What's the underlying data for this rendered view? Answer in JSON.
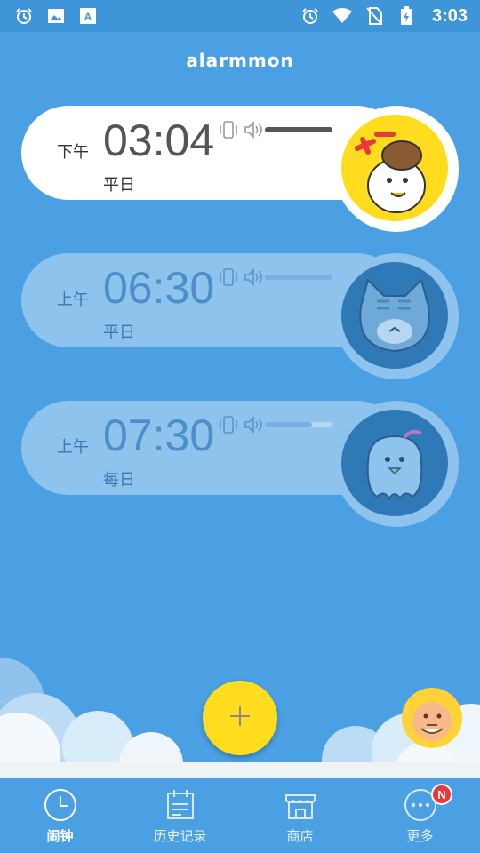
{
  "status_bar": {
    "time": "3:03",
    "left_icons": [
      "alarm-clock-icon",
      "image-icon",
      "text-a-icon"
    ],
    "right_icons": [
      "alarm-clock-icon",
      "wifi-icon",
      "no-sim-icon",
      "battery-charging-icon"
    ]
  },
  "app": {
    "logo_text": "alarmmon"
  },
  "alarms": [
    {
      "ampm": "下午",
      "time": "03:04",
      "days": "平日",
      "enabled": true,
      "volume_level": 1.0,
      "character_icon": "duck-detective-icon"
    },
    {
      "ampm": "上午",
      "time": "06:30",
      "days": "平日",
      "enabled": false,
      "volume_level": 1.0,
      "character_icon": "cat-icon"
    },
    {
      "ampm": "上午",
      "time": "07:30",
      "days": "每日",
      "enabled": false,
      "volume_level": 0.7,
      "character_icon": "chick-icon"
    }
  ],
  "fab": {
    "icon": "plus-icon"
  },
  "nav": {
    "items": [
      {
        "label": "闹钟",
        "icon": "clock-icon",
        "active": true
      },
      {
        "label": "历史记录",
        "icon": "calendar-icon",
        "active": false
      },
      {
        "label": "商店",
        "icon": "store-icon",
        "active": false
      },
      {
        "label": "更多",
        "icon": "more-icon",
        "active": false,
        "badge": "N"
      }
    ]
  },
  "colors": {
    "background": "#4aa0e2",
    "accent_yellow": "#ffdd1e",
    "badge_red": "#e8383d"
  }
}
